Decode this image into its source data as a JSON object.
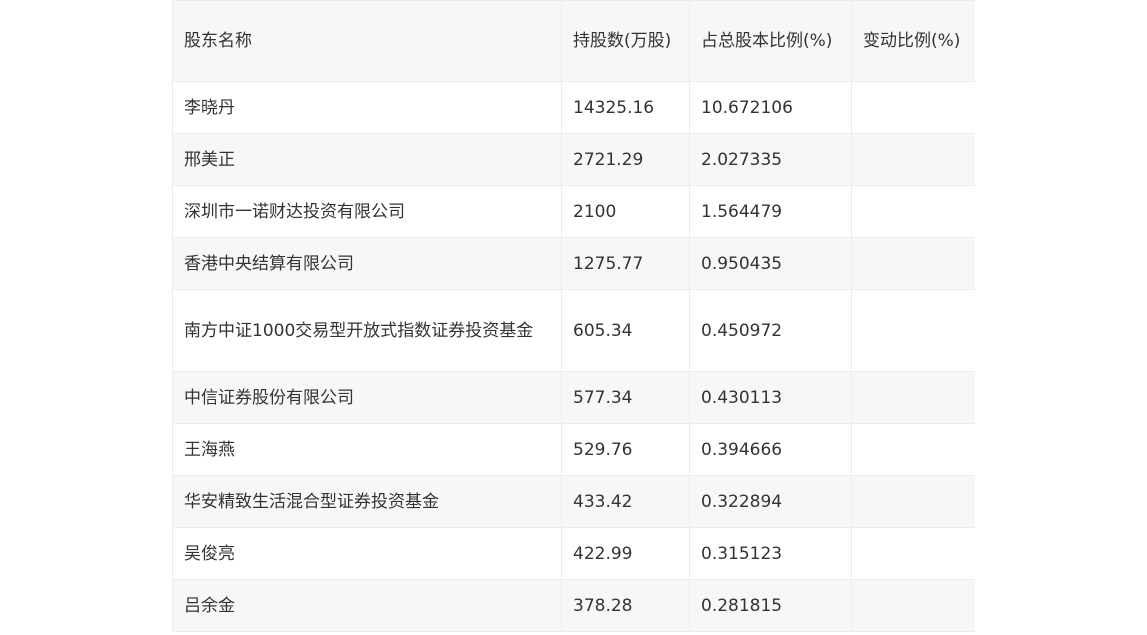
{
  "table": {
    "headers": {
      "name": "股东名称",
      "shares": "持股数(万股)",
      "ratio": "占总股本比例(%)",
      "change": "变动比例(%)"
    },
    "rows": [
      {
        "name": "李晓丹",
        "shares": "14325.16",
        "ratio": "10.672106",
        "change": ""
      },
      {
        "name": "邢美正",
        "shares": "2721.29",
        "ratio": "2.027335",
        "change": ""
      },
      {
        "name": "深圳市一诺财达投资有限公司",
        "shares": "2100",
        "ratio": "1.564479",
        "change": ""
      },
      {
        "name": "香港中央结算有限公司",
        "shares": "1275.77",
        "ratio": "0.950435",
        "change": ""
      },
      {
        "name": "南方中证1000交易型开放式指数证券投资基金",
        "shares": "605.34",
        "ratio": "0.450972",
        "change": ""
      },
      {
        "name": "中信证券股份有限公司",
        "shares": "577.34",
        "ratio": "0.430113",
        "change": ""
      },
      {
        "name": "王海燕",
        "shares": "529.76",
        "ratio": "0.394666",
        "change": ""
      },
      {
        "name": "华安精致生活混合型证券投资基金",
        "shares": "433.42",
        "ratio": "0.322894",
        "change": ""
      },
      {
        "name": "吴俊亮",
        "shares": "422.99",
        "ratio": "0.315123",
        "change": ""
      },
      {
        "name": "吕余金",
        "shares": "378.28",
        "ratio": "0.281815",
        "change": ""
      }
    ]
  }
}
